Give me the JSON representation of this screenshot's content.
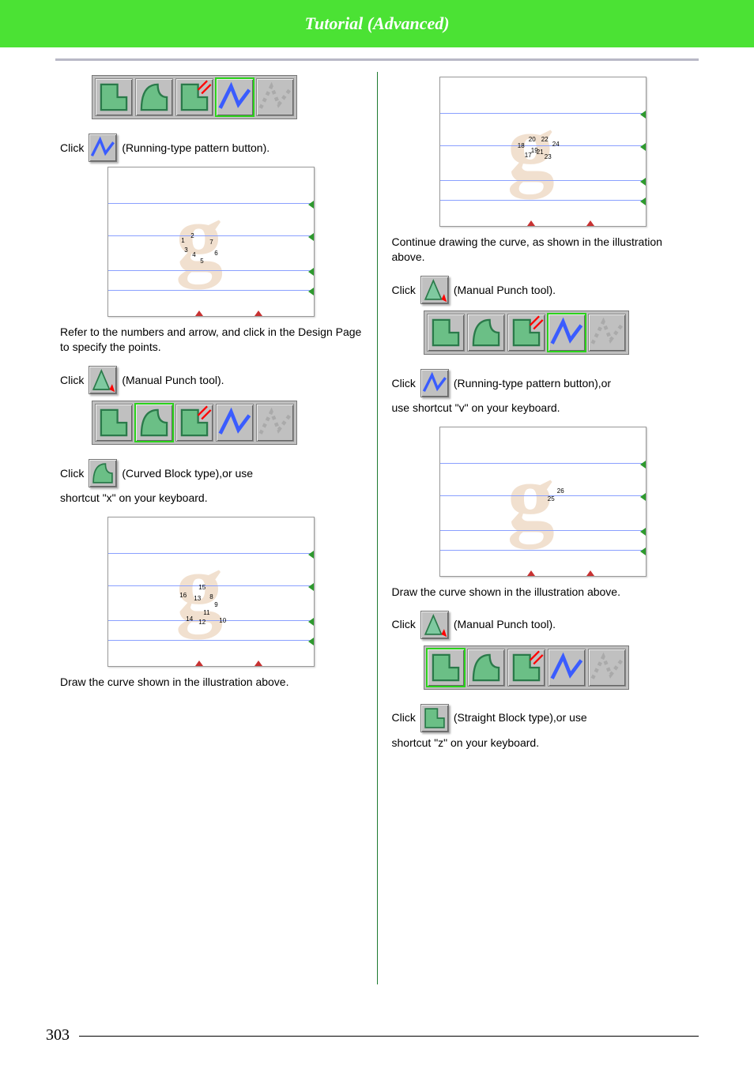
{
  "header": {
    "title": "Tutorial (Advanced)"
  },
  "page_number": "303",
  "left": {
    "click1_pre": "Click",
    "click1_post": "(Running-type pattern button).",
    "refer": "Refer to the numbers and arrow, and click in the Design Page to specify the points.",
    "click2_pre": "Click",
    "click2_post": "(Manual Punch tool).",
    "click3_pre": "Click",
    "click3_post": "(Curved Block type),or use",
    "click3_line2": "shortcut \"x\" on your keyboard.",
    "draw_curve": "Draw the curve shown in the illustration above.",
    "points1": [
      "1",
      "2",
      "3",
      "4",
      "5",
      "6",
      "7"
    ],
    "points2": [
      "8",
      "9",
      "10",
      "11",
      "12",
      "13",
      "14",
      "15",
      "16"
    ]
  },
  "right": {
    "continue": "Continue drawing the curve, as shown in the illustration above.",
    "click4_pre": "Click",
    "click4_post": "(Manual Punch tool).",
    "click5_pre": "Click",
    "click5_post": "(Running-type pattern button),or",
    "click5_line2": "use shortcut \"v\" on your keyboard.",
    "draw_curve": "Draw the curve shown in the illustration above.",
    "click6_pre": "Click",
    "click6_post": "(Manual Punch tool).",
    "click7_pre": "Click",
    "click7_post": "(Straight Block type),or use",
    "click7_line2": "shortcut \"z\" on your keyboard.",
    "points1": [
      "17",
      "18",
      "19",
      "20",
      "21",
      "22",
      "23",
      "24"
    ],
    "points2": [
      "25",
      "26"
    ]
  },
  "toolbar_icons": [
    "straight-block",
    "curved-block",
    "semi-auto-block",
    "running",
    "feed"
  ]
}
